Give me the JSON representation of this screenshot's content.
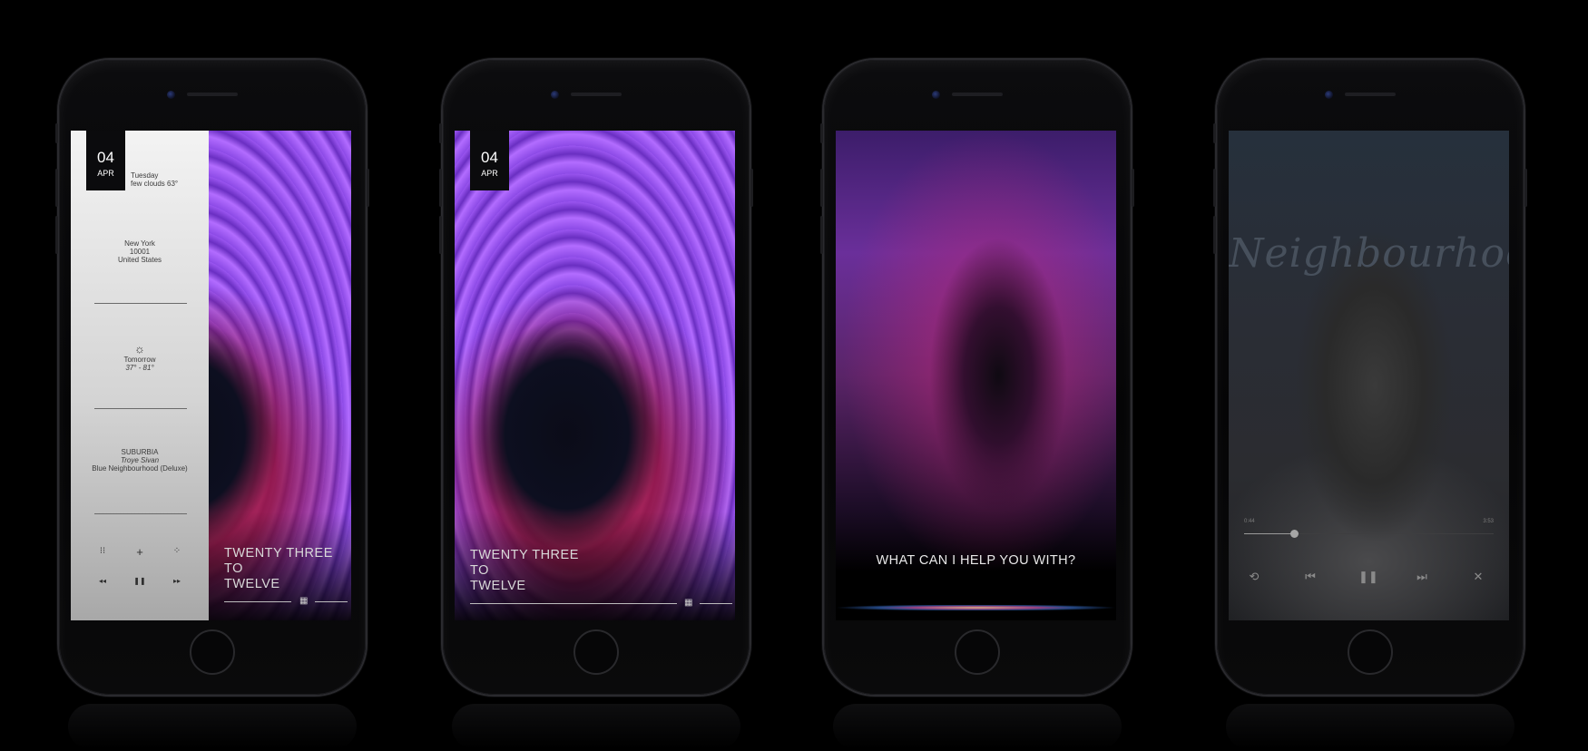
{
  "phones": [
    {
      "date": {
        "day": "04",
        "month": "APR"
      },
      "weather_today": {
        "day": "Tuesday",
        "summary": "few clouds 63°"
      },
      "location": {
        "city": "New York",
        "zip": "10001",
        "country": "United States"
      },
      "forecast": {
        "icon": "sun-icon",
        "label": "Tomorrow",
        "range": "37° - 81°"
      },
      "now_playing": {
        "title": "SUBURBIA",
        "artist": "Troye Sivan",
        "album": "Blue Neighbourhood (Deluxe)"
      },
      "controls": {
        "grid": "⁝⁝",
        "add": "+",
        "shuffle": "⁘",
        "prev": "◂◂",
        "pause": "❚❚",
        "next": "▸▸"
      },
      "clock_text": [
        "TWENTY THREE",
        "TO",
        "TWELVE"
      ],
      "slider_icon": "dial-icon"
    },
    {
      "date": {
        "day": "04",
        "month": "APR"
      },
      "clock_text": [
        "TWENTY THREE",
        "TO",
        "TWELVE"
      ],
      "slider_icon": "dial-icon"
    },
    {
      "siri_prompt": "WHAT CAN I HELP YOU WITH?"
    },
    {
      "time_elapsed": "0:44",
      "time_total": "3:53",
      "progress": 0.2,
      "controls": {
        "repeat": "⟲",
        "prev": "⏮",
        "pause": "❚❚",
        "next": "⏭",
        "shuffle": "✕"
      }
    }
  ]
}
